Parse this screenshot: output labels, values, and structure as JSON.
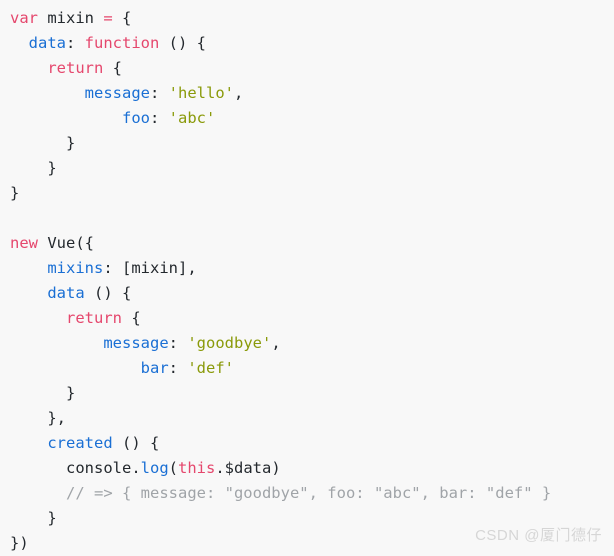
{
  "editor": {
    "background_color": "#f8f8f8",
    "language": "javascript",
    "font_size_px": 15.5,
    "line_height_px": 25
  },
  "theme": {
    "keyword_color": "#e5476d",
    "property_color": "#1a6fd4",
    "string_color": "#8a9a0a",
    "plain_color": "#24292e",
    "comment_color": "#a0a4a8",
    "watermark_color": "#d6d6d6"
  },
  "code": {
    "full_text": "var mixin = {\n  data: function () {\n    return {\n        message: 'hello',\n            foo: 'abc'\n      }\n    }\n}\n\nnew Vue({\n    mixins: [mixin],\n    data () {\n      return {\n          message: 'goodbye',\n              bar: 'def'\n      }\n    },\n    created () {\n      console.log(this.$data)\n      // => { message: \"goodbye\", foo: \"abc\", bar: \"def\" }\n    }\n})",
    "lines": [
      {
        "n": 1,
        "indent": 0,
        "tokens": [
          {
            "t": "var",
            "c": "keyword"
          },
          {
            "t": " ",
            "c": "plain"
          },
          {
            "t": "mixin",
            "c": "plain"
          },
          {
            "t": " ",
            "c": "plain"
          },
          {
            "t": "=",
            "c": "keyword"
          },
          {
            "t": " ",
            "c": "plain"
          },
          {
            "t": "{",
            "c": "punct"
          }
        ]
      },
      {
        "n": 2,
        "indent": 2,
        "tokens": [
          {
            "t": "data",
            "c": "property"
          },
          {
            "t": ": ",
            "c": "punct"
          },
          {
            "t": "function",
            "c": "keyword"
          },
          {
            "t": " () {",
            "c": "punct"
          }
        ]
      },
      {
        "n": 3,
        "indent": 4,
        "tokens": [
          {
            "t": "return",
            "c": "keyword"
          },
          {
            "t": " {",
            "c": "punct"
          }
        ]
      },
      {
        "n": 4,
        "indent": 8,
        "tokens": [
          {
            "t": "message",
            "c": "property"
          },
          {
            "t": ": ",
            "c": "punct"
          },
          {
            "t": "'hello'",
            "c": "string"
          },
          {
            "t": ",",
            "c": "punct"
          }
        ]
      },
      {
        "n": 5,
        "indent": 12,
        "tokens": [
          {
            "t": "foo",
            "c": "property"
          },
          {
            "t": ": ",
            "c": "punct"
          },
          {
            "t": "'abc'",
            "c": "string"
          }
        ]
      },
      {
        "n": 6,
        "indent": 6,
        "tokens": [
          {
            "t": "}",
            "c": "punct"
          }
        ]
      },
      {
        "n": 7,
        "indent": 4,
        "tokens": [
          {
            "t": "}",
            "c": "punct"
          }
        ]
      },
      {
        "n": 8,
        "indent": 0,
        "tokens": [
          {
            "t": "}",
            "c": "punct"
          }
        ]
      },
      {
        "n": 9,
        "indent": 0,
        "tokens": []
      },
      {
        "n": 10,
        "indent": 0,
        "tokens": [
          {
            "t": "new",
            "c": "keyword"
          },
          {
            "t": " ",
            "c": "plain"
          },
          {
            "t": "Vue",
            "c": "plain"
          },
          {
            "t": "({",
            "c": "punct"
          }
        ]
      },
      {
        "n": 11,
        "indent": 4,
        "tokens": [
          {
            "t": "mixins",
            "c": "property"
          },
          {
            "t": ": [",
            "c": "punct"
          },
          {
            "t": "mixin",
            "c": "plain"
          },
          {
            "t": "],",
            "c": "punct"
          }
        ]
      },
      {
        "n": 12,
        "indent": 4,
        "tokens": [
          {
            "t": "data",
            "c": "property"
          },
          {
            "t": " () {",
            "c": "punct"
          }
        ]
      },
      {
        "n": 13,
        "indent": 6,
        "tokens": [
          {
            "t": "return",
            "c": "keyword"
          },
          {
            "t": " {",
            "c": "punct"
          }
        ]
      },
      {
        "n": 14,
        "indent": 10,
        "tokens": [
          {
            "t": "message",
            "c": "property"
          },
          {
            "t": ": ",
            "c": "punct"
          },
          {
            "t": "'goodbye'",
            "c": "string"
          },
          {
            "t": ",",
            "c": "punct"
          }
        ]
      },
      {
        "n": 15,
        "indent": 14,
        "tokens": [
          {
            "t": "bar",
            "c": "property"
          },
          {
            "t": ": ",
            "c": "punct"
          },
          {
            "t": "'def'",
            "c": "string"
          }
        ]
      },
      {
        "n": 16,
        "indent": 6,
        "tokens": [
          {
            "t": "}",
            "c": "punct"
          }
        ]
      },
      {
        "n": 17,
        "indent": 4,
        "tokens": [
          {
            "t": "},",
            "c": "punct"
          }
        ]
      },
      {
        "n": 18,
        "indent": 4,
        "tokens": [
          {
            "t": "created",
            "c": "property"
          },
          {
            "t": " () {",
            "c": "punct"
          }
        ]
      },
      {
        "n": 19,
        "indent": 6,
        "tokens": [
          {
            "t": "console",
            "c": "plain"
          },
          {
            "t": ".",
            "c": "punct"
          },
          {
            "t": "log",
            "c": "func"
          },
          {
            "t": "(",
            "c": "punct"
          },
          {
            "t": "this",
            "c": "this"
          },
          {
            "t": ".$data",
            "c": "plain"
          },
          {
            "t": ")",
            "c": "punct"
          }
        ]
      },
      {
        "n": 20,
        "indent": 6,
        "tokens": [
          {
            "t": "// => { message: \"goodbye\", foo: \"abc\", bar: \"def\" }",
            "c": "comment"
          }
        ]
      },
      {
        "n": 21,
        "indent": 4,
        "tokens": [
          {
            "t": "}",
            "c": "punct"
          }
        ]
      },
      {
        "n": 22,
        "indent": 0,
        "tokens": [
          {
            "t": "})",
            "c": "punct"
          }
        ]
      }
    ]
  },
  "watermark": {
    "text": "CSDN @厦门德仔"
  }
}
